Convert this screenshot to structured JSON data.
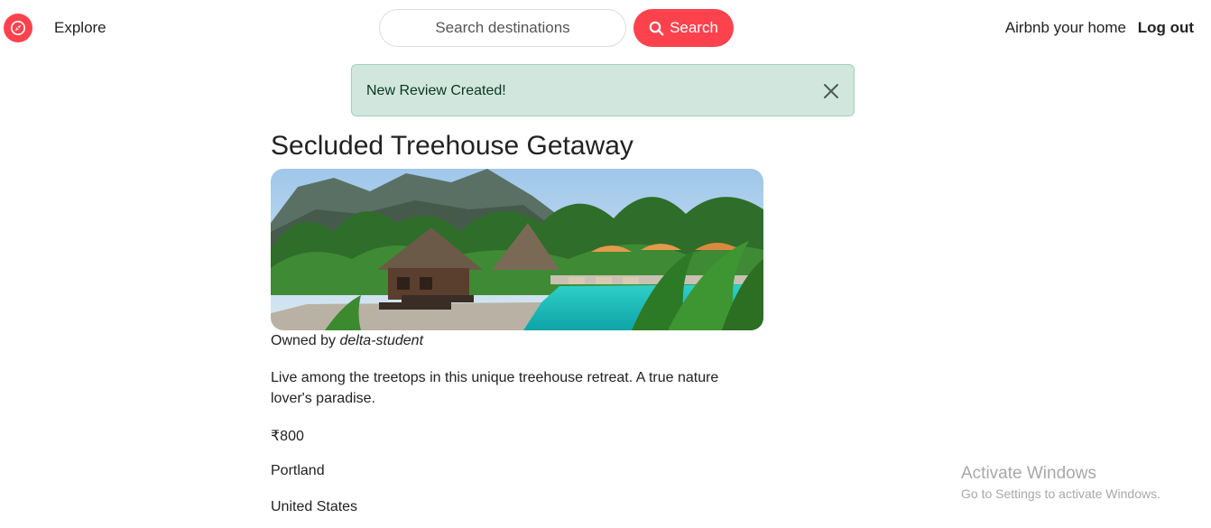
{
  "navbar": {
    "logo_icon": "compass-icon",
    "explore_label": "Explore",
    "search_placeholder": "Search destinations",
    "search_value": "",
    "search_button_label": "Search",
    "search_icon": "search-icon",
    "host_label": "Airbnb your home",
    "logout_label": "Log out",
    "accent_color": "#fe424d"
  },
  "flash": {
    "message": "New Review Created!",
    "close_icon": "close-icon",
    "background_color": "#d1e7dd"
  },
  "listing": {
    "title": "Secluded Treehouse Getaway",
    "image_alt": "",
    "owner_prefix": "Owned by",
    "owner_name": "delta-student",
    "description": "Live among the treetops in this unique treehouse retreat. A true nature lover's paradise.",
    "price": "₹800",
    "location": "Portland",
    "country": "United States"
  },
  "watermark": {
    "title": "Activate Windows",
    "subtitle": "Go to Settings to activate Windows."
  }
}
